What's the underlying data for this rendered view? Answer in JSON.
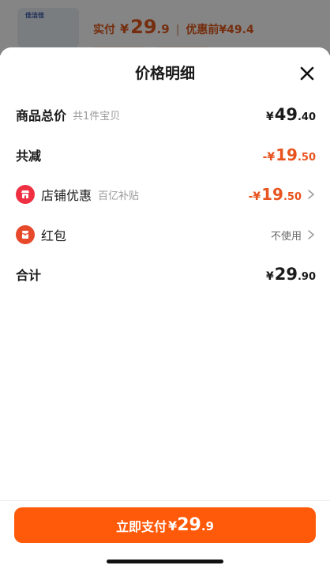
{
  "background_page": {
    "thumb_label": "佳洁佳",
    "paid_label": "实付",
    "currency": "¥",
    "paid_int": "29",
    "paid_dec": ".9",
    "separator": "|",
    "orig_label": "优惠前",
    "orig_price": "¥49.4"
  },
  "sheet": {
    "title": "价格明细"
  },
  "rows": {
    "total": {
      "label": "商品总价",
      "sub": "共1件宝贝",
      "currency": "¥",
      "int": "49",
      "dec": ".40"
    },
    "reduction": {
      "label": "共减",
      "prefix": "-¥",
      "int": "19",
      "dec": ".50"
    },
    "store_discount": {
      "label": "店铺优惠",
      "sub": "百亿补贴",
      "prefix": "-¥",
      "int": "19",
      "dec": ".50",
      "icon": "store-icon"
    },
    "red_packet": {
      "label": "红包",
      "value": "不使用",
      "icon": "red-packet-icon"
    },
    "sum": {
      "label": "合计",
      "currency": "¥",
      "int": "29",
      "dec": ".90"
    }
  },
  "pay_button": {
    "label": "立即支付",
    "currency": "¥",
    "int": "29",
    "dec": ".9"
  },
  "colors": {
    "accent": "#ff5a0a",
    "discount": "#e8531f",
    "store_badge": "#ee3042"
  }
}
